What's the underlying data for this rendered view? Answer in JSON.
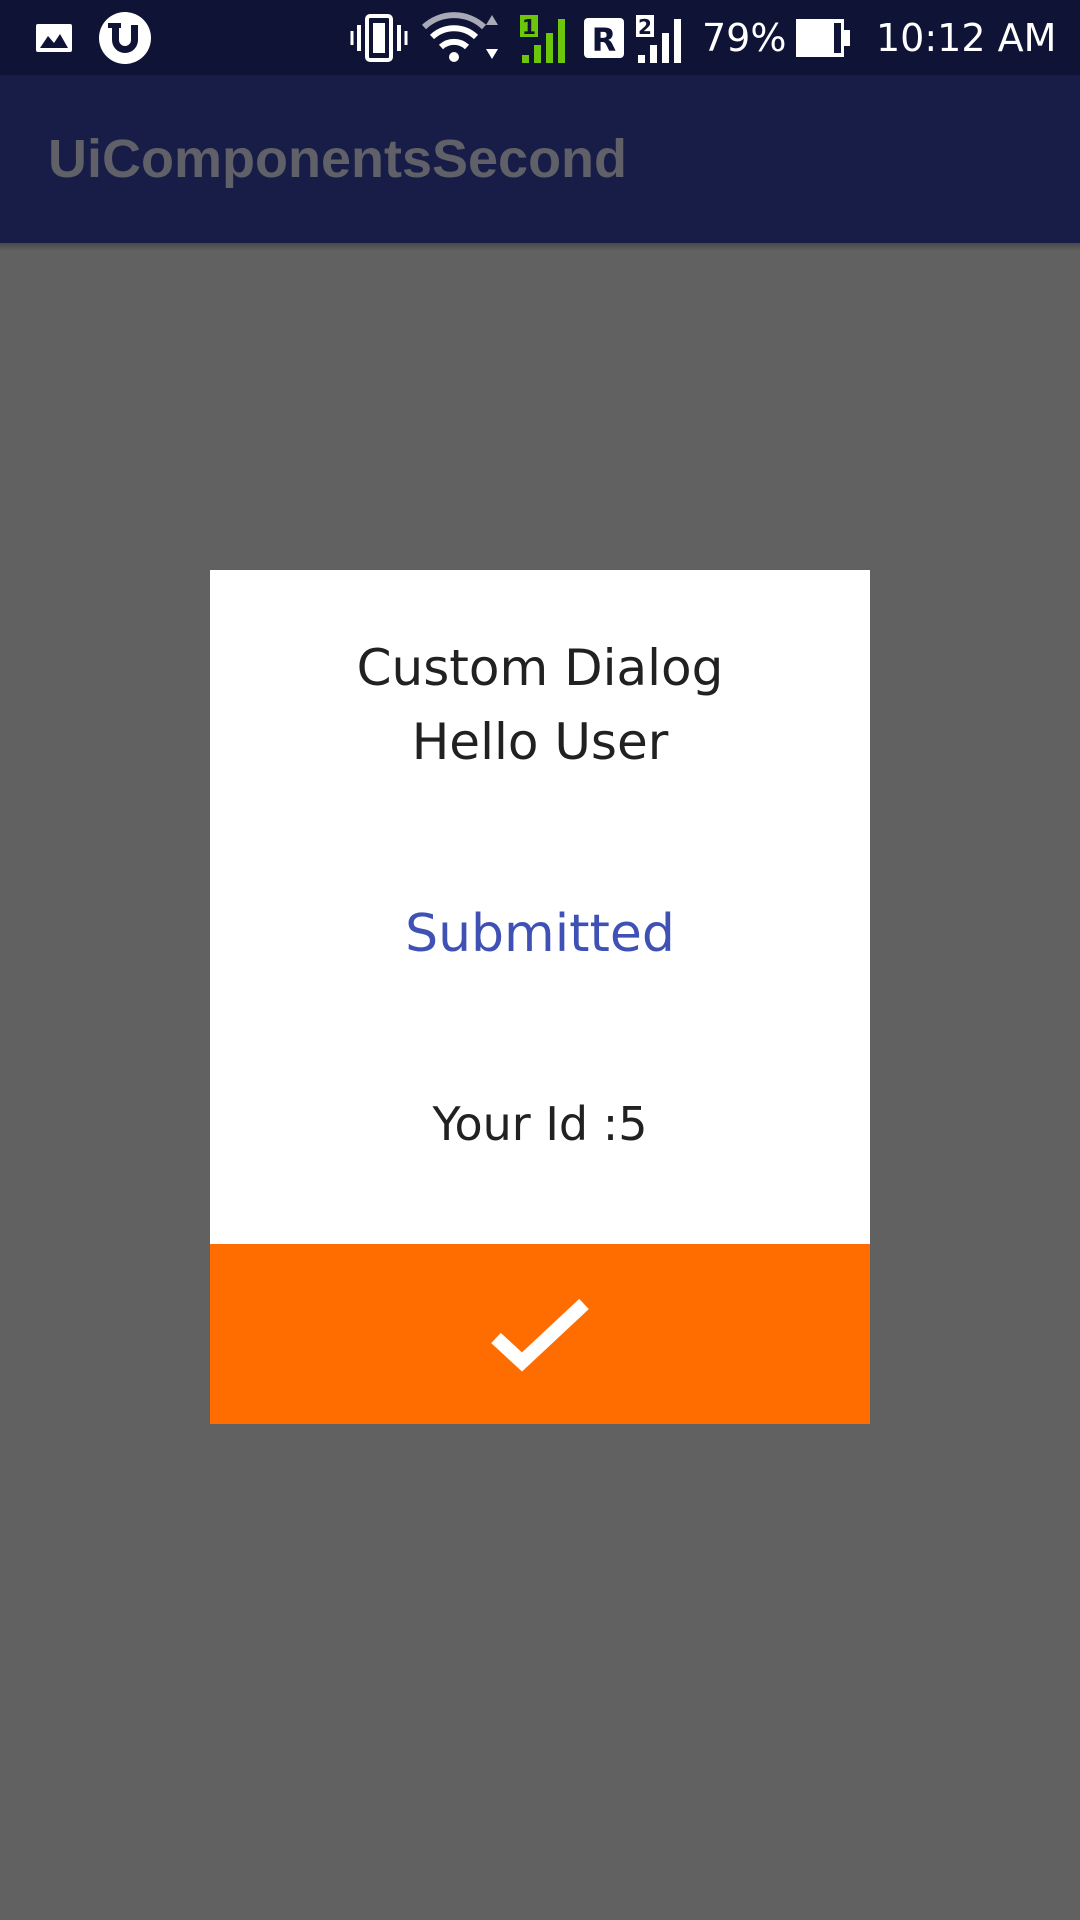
{
  "status_bar": {
    "battery_percent": "79%",
    "time": "10:12 AM",
    "sim1_label": "1",
    "sim2_label": "2",
    "roaming_label": "R",
    "icons": [
      "gallery-icon",
      "utorrent-icon",
      "vibrate-icon",
      "wifi-icon",
      "signal-sim1-icon",
      "roaming-icon",
      "signal-sim2-icon",
      "battery-icon"
    ]
  },
  "app_bar": {
    "title": "UiComponentsSecond"
  },
  "dialog": {
    "title": "Custom Dialog",
    "greeting": "Hello User",
    "status": "Submitted",
    "id_text": "Your Id :5",
    "confirm_icon": "checkmark-icon"
  },
  "colors": {
    "status_bar_bg": "#0f1436",
    "app_bar_bg": "#181d47",
    "scrim": "#616161",
    "dialog_bg": "#ffffff",
    "accent_blue": "#3f51b5",
    "button_orange": "#ff6d00",
    "signal_green": "#6cc60c"
  }
}
